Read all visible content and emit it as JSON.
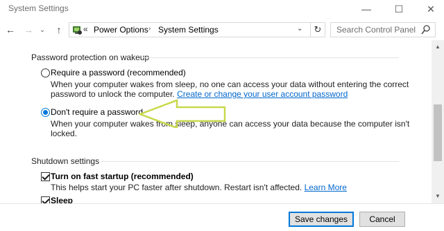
{
  "window": {
    "title": "System Settings",
    "controls": {
      "minimize": "—",
      "maximize": "☐",
      "close": "✕"
    }
  },
  "nav": {
    "back": "←",
    "forward": "→",
    "recent": "⌄",
    "up": "↑",
    "address": {
      "chevron": "«",
      "crumbs": [
        "Power Options",
        "System Settings"
      ],
      "separator": "›",
      "dropdown": "⌄",
      "refresh": "↻"
    },
    "search": {
      "placeholder": "Search Control Panel"
    }
  },
  "password_section": {
    "title": "Password protection on wakeup",
    "options": [
      {
        "label": "Require a password (recommended)",
        "checked": false,
        "desc_line1": "When your computer wakes from sleep, no one can access your data without entering the correct",
        "desc_line2": "password to unlock the computer.",
        "link": "Create or change your user account password"
      },
      {
        "label": "Don't require a password",
        "checked": true,
        "desc_line1": "When your computer wakes from sleep, anyone can access your data because the computer isn't",
        "desc_line2": "locked."
      }
    ]
  },
  "shutdown_section": {
    "title": "Shutdown settings",
    "items": [
      {
        "label": "Turn on fast startup (recommended)",
        "checked": true,
        "desc": "This helps start your PC faster after shutdown. Restart isn't affected.",
        "link": "Learn More"
      },
      {
        "label": "Sleep",
        "checked": true
      }
    ]
  },
  "scrollbar": {
    "up": "▲",
    "down": "▼"
  },
  "footer": {
    "save": "Save changes",
    "cancel": "Cancel"
  },
  "colors": {
    "accent": "#0078d7",
    "link": "#0066cc",
    "annotation_arrow": "#c8d94a"
  }
}
